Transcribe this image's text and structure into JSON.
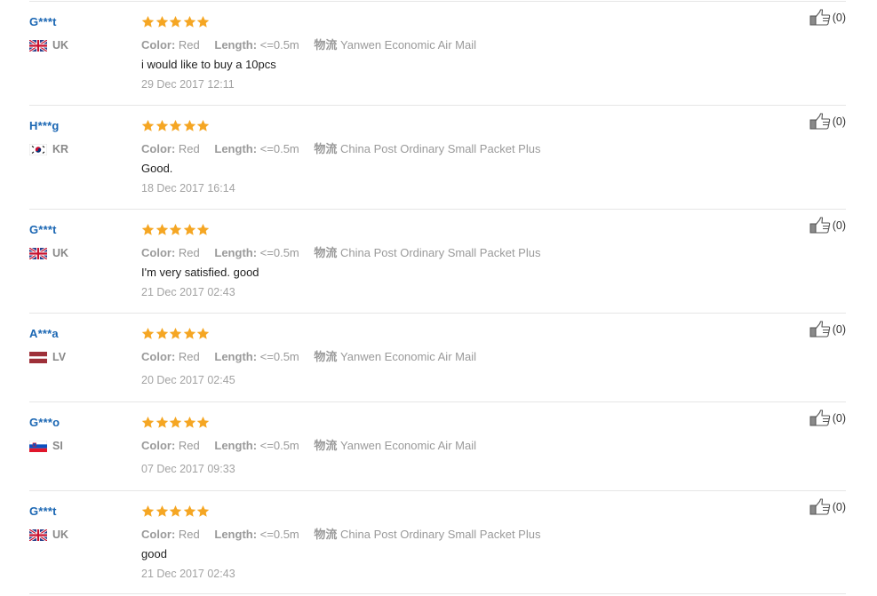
{
  "colors": {
    "username": "#1a66b3",
    "star": "#f5a623",
    "divider": "#e6e6e6",
    "muted": "#9a9a9a"
  },
  "labels": {
    "color_key": "Color:",
    "length_key": "Length:",
    "shipping_key": "物流"
  },
  "reviews": [
    {
      "name": "G***t",
      "country": "UK",
      "flag": "uk-flag-icon",
      "stars": 5,
      "color": "Red",
      "length": "<=0.5m",
      "shipping": "Yanwen Economic Air Mail",
      "text": "i would like to buy a 10pcs",
      "date": "29 Dec 2017 12:11",
      "helpful": "(0)"
    },
    {
      "name": "H***g",
      "country": "KR",
      "flag": "kr-flag-icon",
      "stars": 5,
      "color": "Red",
      "length": "<=0.5m",
      "shipping": "China Post Ordinary Small Packet Plus",
      "text": "Good.",
      "date": "18 Dec 2017 16:14",
      "helpful": "(0)"
    },
    {
      "name": "G***t",
      "country": "UK",
      "flag": "uk-flag-icon",
      "stars": 5,
      "color": "Red",
      "length": "<=0.5m",
      "shipping": "China Post Ordinary Small Packet Plus",
      "text": "I'm very satisfied. good",
      "date": "21 Dec 2017 02:43",
      "helpful": "(0)"
    },
    {
      "name": "A***a",
      "country": "LV",
      "flag": "lv-flag-icon",
      "stars": 5,
      "color": "Red",
      "length": "<=0.5m",
      "shipping": "Yanwen Economic Air Mail",
      "text": "",
      "date": "20 Dec 2017 02:45",
      "helpful": "(0)"
    },
    {
      "name": "G***o",
      "country": "SI",
      "flag": "si-flag-icon",
      "stars": 5,
      "color": "Red",
      "length": "<=0.5m",
      "shipping": "Yanwen Economic Air Mail",
      "text": "",
      "date": "07 Dec 2017 09:33",
      "helpful": "(0)"
    },
    {
      "name": "G***t",
      "country": "UK",
      "flag": "uk-flag-icon",
      "stars": 5,
      "color": "Red",
      "length": "<=0.5m",
      "shipping": "China Post Ordinary Small Packet Plus",
      "text": "good",
      "date": "21 Dec 2017 02:43",
      "helpful": "(0)"
    }
  ]
}
